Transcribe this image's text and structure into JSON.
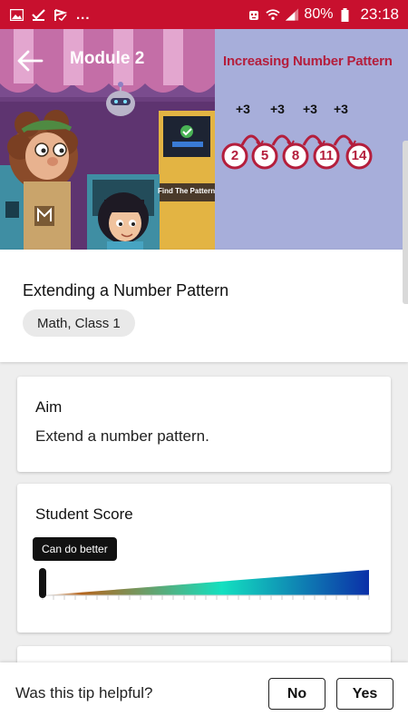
{
  "status_bar": {
    "dots": "...",
    "battery": "80%",
    "time": "23:18",
    "icons": [
      "image-icon",
      "check-icon",
      "flag-icon",
      "robot-icon",
      "wifi-icon",
      "signal-icon",
      "battery-icon"
    ]
  },
  "header": {
    "title": "Module 2"
  },
  "hero": {
    "pattern_title": "Increasing Number Pattern",
    "step_label": "+3",
    "sequence": [
      "2",
      "5",
      "8",
      "11",
      "14"
    ],
    "screen_label": "Find The Pattern",
    "accent_color": "#b41e3c"
  },
  "lesson": {
    "title": "Extending a Number Pattern",
    "tag": "Math, Class 1"
  },
  "aim": {
    "heading": "Aim",
    "text": "Extend a number pattern."
  },
  "score": {
    "heading": "Student Score",
    "tooltip": "Can do better",
    "level": 0.0,
    "gradient": [
      "#ffffff",
      "#b5651d",
      "#13e0c0",
      "#0b2fa8"
    ]
  },
  "feedback": {
    "question": "Was this tip helpful?",
    "no_label": "No",
    "yes_label": "Yes"
  }
}
